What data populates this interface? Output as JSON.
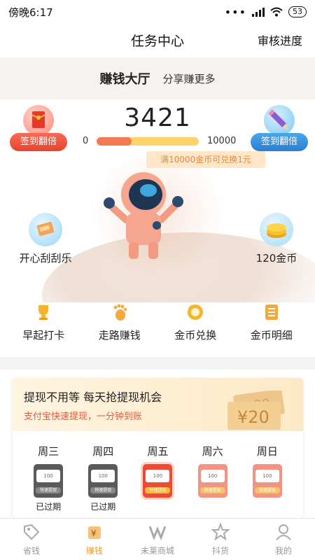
{
  "status_bar": {
    "time": "傍晚6:17",
    "battery": "53"
  },
  "nav": {
    "title": "任务中心",
    "right_link": "审核进度"
  },
  "hall": {
    "title": "赚钱大厅",
    "subtitle": "分享赚更多"
  },
  "coins": {
    "count": "3421",
    "progress_min": "0",
    "progress_max": "10000",
    "progress_fraction": 0.34,
    "exchange_tip": "满10000金币可兑换1元"
  },
  "signin": {
    "left_label": "签到翻倍",
    "right_label": "签到翻倍"
  },
  "features": {
    "left_label": "开心刮刮乐",
    "right_label": "120金币"
  },
  "quick_actions": [
    {
      "label": "早起打卡",
      "icon": "trophy-icon"
    },
    {
      "label": "走路赚钱",
      "icon": "footprint-icon"
    },
    {
      "label": "金币兑换",
      "icon": "coin-exchange-icon"
    },
    {
      "label": "金币明细",
      "icon": "list-icon"
    }
  ],
  "withdraw_card": {
    "title": "提现不用等 每天抢提现机会",
    "subtitle": "支付宝快速提现，一分钟到账",
    "ticket_front": "¥20",
    "ticket_back": "20",
    "days": [
      {
        "label": "周三",
        "status": "已过期",
        "state": "expired"
      },
      {
        "label": "周四",
        "status": "已过期",
        "state": "expired"
      },
      {
        "label": "周五",
        "status": "",
        "state": "today"
      },
      {
        "label": "周六",
        "status": "",
        "state": "future"
      },
      {
        "label": "周日",
        "status": "",
        "state": "future"
      }
    ],
    "envelope_amount": "100",
    "envelope_tag": "快速提现"
  },
  "tabbar": [
    {
      "label": "省钱",
      "icon": "tag-icon",
      "active": false
    },
    {
      "label": "赚钱",
      "icon": "money-bag-icon",
      "active": true
    },
    {
      "label": "未莱商城",
      "icon": "mall-icon",
      "active": false
    },
    {
      "label": "抖货",
      "icon": "star-icon",
      "active": false
    },
    {
      "label": "我的",
      "icon": "user-icon",
      "active": false
    }
  ],
  "colors": {
    "accent": "#f09a2a",
    "red": "#ee4b37",
    "blue": "#2b7fd1"
  }
}
